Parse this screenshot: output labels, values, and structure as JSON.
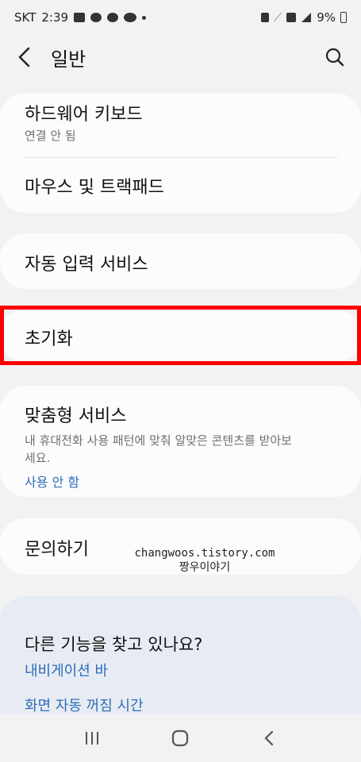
{
  "status_bar": {
    "carrier": "SKT",
    "time": "2:39",
    "battery": "9%"
  },
  "app_bar": {
    "title": "일반"
  },
  "sections": {
    "keyboard": {
      "title": "하드웨어 키보드",
      "subtitle": "연결 안 됨"
    },
    "mouse": {
      "title": "마우스 및 트랙패드"
    },
    "autofill": {
      "title": "자동 입력 서비스"
    },
    "reset": {
      "title": "초기화"
    },
    "custom": {
      "title": "맞춤형 서비스",
      "description": "내 휴대전화 사용 패턴에 맞춰 알맞은 콘텐츠를 받아보세요.",
      "status": "사용 안 함"
    },
    "contact": {
      "title": "문의하기"
    }
  },
  "help": {
    "title": "다른 기능을 찾고 있나요?",
    "links": [
      "내비게이션 바",
      "화면 자동 꺼짐 시간"
    ]
  },
  "watermark": {
    "line1": "changwoos.tistory.com",
    "line2": "짱우이야기"
  },
  "colors": {
    "background": "#f2f2f4",
    "card": "#fcfcfd",
    "link": "#2f6db5",
    "highlight": "#ff0000",
    "help_card": "#e7ecf4"
  }
}
